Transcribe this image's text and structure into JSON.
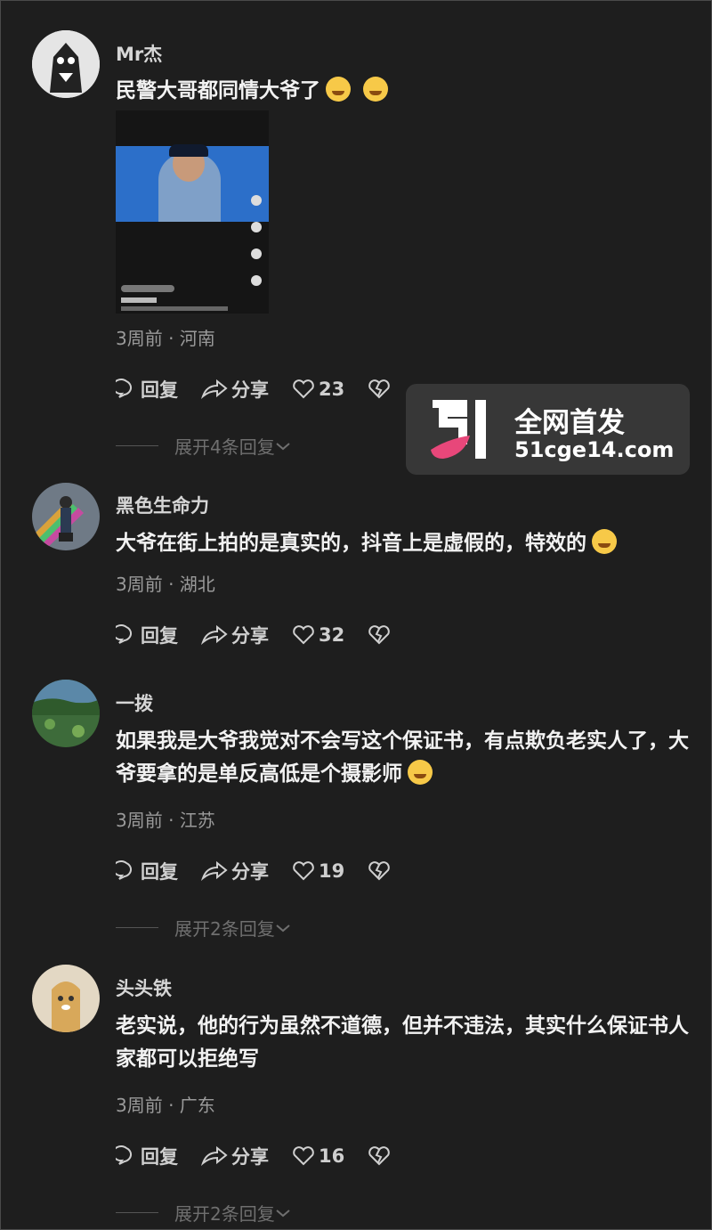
{
  "comments": [
    {
      "username": "Mr杰",
      "text": "民警大哥都同情大爷了",
      "meta": "3周前 · 河南",
      "reply": "回复",
      "share": "分享",
      "likes": "23",
      "expand": "展开4条回复",
      "emoji": [
        "crying-face",
        "crying-face"
      ]
    },
    {
      "username": "黑色生命力",
      "text": "大爷在街上拍的是真实的，抖音上是虚假的，特效的",
      "meta": "3周前 · 湖北",
      "reply": "回复",
      "share": "分享",
      "likes": "32",
      "emoji": [
        "rolling-laughing-face"
      ]
    },
    {
      "username": "一拨",
      "text": "如果我是大爷我觉对不会写这个保证书，有点欺负老实人了，大爷要拿的是单反高低是个摄影师",
      "meta": "3周前 · 江苏",
      "reply": "回复",
      "share": "分享",
      "likes": "19",
      "expand": "展开2条回复",
      "emoji": [
        "sleepy-face"
      ]
    },
    {
      "username": "头头铁",
      "text": "老实说，他的行为虽然不道德，但并不违法，其实什么保证书人家都可以拒绝写",
      "meta": "3周前 · 广东",
      "reply": "回复",
      "share": "分享",
      "likes": "16",
      "expand": "展开2条回复"
    }
  ],
  "watermark": {
    "title": "全网首发",
    "url": "51cge14.com",
    "logo_colors": {
      "white": "#ffffff",
      "pink": "#e8477a"
    }
  },
  "colors": {
    "background": "#1e1e1e",
    "text": "#f2f2f2",
    "meta": "#9a9a9a"
  }
}
